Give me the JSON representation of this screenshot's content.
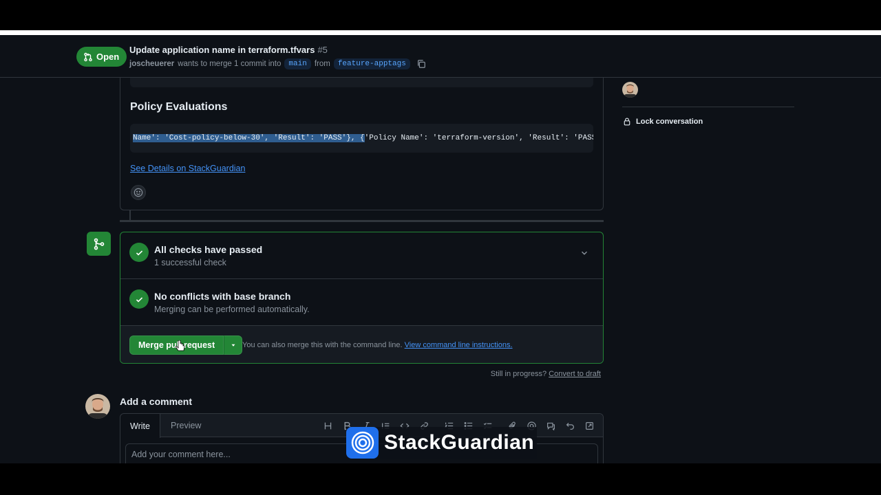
{
  "header": {
    "state_label": "Open",
    "title": "Update application name in terraform.tfvars",
    "number": "#5",
    "author": "joscheuerer",
    "merge_text": "wants to merge 1 commit into",
    "base_branch": "main",
    "from_text": "from",
    "head_branch": "feature-apptags"
  },
  "comment": {
    "heading": "Policy Evaluations",
    "code_selected": "Name': 'Cost-policy-below-30', 'Result': 'PASS'}, {",
    "code_rest": "'Policy Name': 'terraform-version', 'Result': 'PASS'}]",
    "details_link": "See Details on StackGuardian"
  },
  "merge": {
    "checks_title": "All checks have passed",
    "checks_sub": "1 successful check",
    "conflicts_title": "No conflicts with base branch",
    "conflicts_sub": "Merging can be performed automatically.",
    "merge_button": "Merge pull request",
    "hint_text": "You can also merge this with the command line.",
    "hint_link": "View command line instructions.",
    "draft_text": "Still in progress?",
    "draft_link": "Convert to draft"
  },
  "add_comment": {
    "title": "Add a comment",
    "tab_write": "Write",
    "tab_preview": "Preview",
    "placeholder": "Add your comment here...",
    "toolbar_icons": [
      "heading-icon",
      "bold-icon",
      "italic-icon",
      "quote-icon",
      "code-icon",
      "link-icon",
      "numbered-list-icon",
      "bullet-list-icon",
      "task-list-icon",
      "attach-icon",
      "mention-icon",
      "cross-reference-icon",
      "undo-icon",
      "fullscreen-icon"
    ]
  },
  "sidebar": {
    "lock_label": "Lock conversation"
  },
  "watermark": {
    "text": "StackGuardian"
  },
  "colors": {
    "background": "#0d1117",
    "success": "#238636",
    "link": "#4493f8",
    "border": "#30363d",
    "muted": "#8b949e"
  }
}
